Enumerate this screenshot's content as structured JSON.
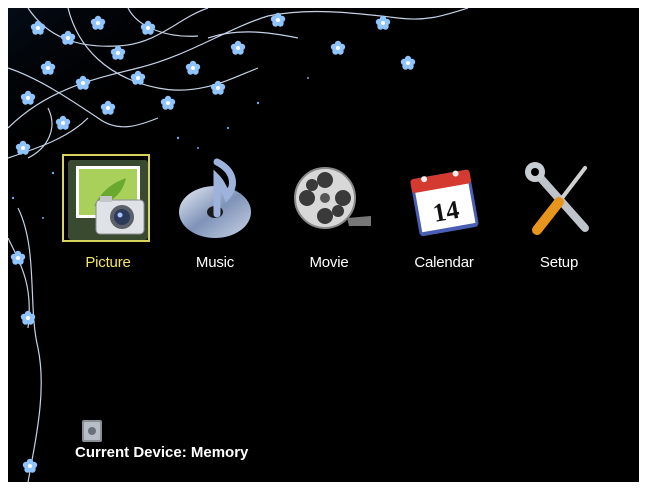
{
  "menu": {
    "selected": "Picture",
    "items": [
      {
        "label": "Picture",
        "icon": "picture-camera-icon"
      },
      {
        "label": "Music",
        "icon": "music-disc-icon"
      },
      {
        "label": "Movie",
        "icon": "film-reel-icon"
      },
      {
        "label": "Calendar",
        "icon": "calendar-icon"
      },
      {
        "label": "Setup",
        "icon": "wrench-screwdriver-icon"
      }
    ]
  },
  "status": {
    "device_text": "Current Device: Memory",
    "device_icon": "memory-card-icon"
  },
  "colors": {
    "background": "#000000",
    "label": "#ffffff",
    "selected_label": "#f3e46c",
    "selection_border": "#d8d35c",
    "decoration": "#4a8fe0"
  }
}
